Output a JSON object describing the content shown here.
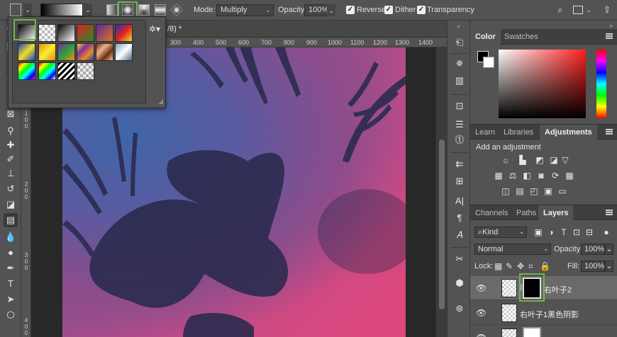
{
  "options_bar": {
    "mode_label": "Mode:",
    "mode_value": "Multiply",
    "opacity_label": "Opacity:",
    "opacity_value": "100%",
    "reverse_label": "Reverse",
    "dither_label": "Dither",
    "transparency_label": "Transparency",
    "reverse_checked": true,
    "dither_checked": true,
    "transparency_checked": true,
    "selected_gradient_type": "radial-gradient",
    "gradient_types": [
      "linear-gradient",
      "radial-gradient",
      "angle-gradient",
      "reflected-gradient",
      "diamond-gradient"
    ],
    "right_icons": [
      "search-icon",
      "workspace-icon",
      "share-icon"
    ]
  },
  "document": {
    "tab_title": "/8) *",
    "hruler_labels": [
      "300",
      "400",
      "500",
      "600",
      "700",
      "800",
      "900",
      "1000",
      "1100",
      "1200",
      "1300",
      "1400",
      "1500"
    ],
    "vruler_labels": [
      "1",
      "0",
      "0",
      "2",
      "0",
      "0",
      "3",
      "0",
      "0",
      "4",
      "0",
      "0"
    ]
  },
  "gradient_picker": {
    "selected_index": 0,
    "presets": [
      "foreground-to-background",
      "foreground-to-transparent",
      "black-white",
      "red-green",
      "violet-orange",
      "blue-red-yellow",
      "blue-yellow-blue",
      "orange-yellow-orange",
      "violet-green-orange",
      "yellow-violet-orange-blue",
      "copper",
      "chrome",
      "spectrum",
      "transparent-rainbow",
      "transparent-stripes",
      "neutral-density"
    ]
  },
  "tools": [
    "move-icon",
    "marquee-icon",
    "lasso-icon",
    "quick-select-icon",
    "crop-icon",
    "frame-icon",
    "eyedropper-icon",
    "healing-icon",
    "brush-icon",
    "stamp-icon",
    "history-brush-icon",
    "eraser-icon",
    "gradient-icon",
    "blur-icon",
    "dodge-icon",
    "pen-icon",
    "type-icon",
    "path-select-icon",
    "shape-icon"
  ],
  "color_panel": {
    "tabs": [
      "Color",
      "Swatches"
    ],
    "active_tab": "Color"
  },
  "adjust_panel": {
    "tabs": [
      "Learn",
      "Libraries",
      "Adjustments"
    ],
    "active_tab": "Adjustments",
    "heading": "Add an adjustment"
  },
  "layers_panel": {
    "tabs": [
      "Channels",
      "Paths",
      "Layers"
    ],
    "active_tab": "Layers",
    "filter_value": "Kind",
    "blend_mode": "Normal",
    "opacity_label": "Opacity:",
    "opacity_value": "100%",
    "lock_label": "Lock:",
    "fill_label": "Fill:",
    "fill_value": "100%",
    "layers": [
      {
        "name": "右叶子2",
        "selected": true,
        "has_mask": true
      },
      {
        "name": "右叶子1黑色阴影",
        "selected": false,
        "has_mask": false
      },
      {
        "name": "",
        "selected": false,
        "has_mask": true
      }
    ]
  },
  "colors": {
    "highlight": "#6fb64a",
    "panel_bg": "#535353",
    "canvas_pink": "#e0477c",
    "canvas_blue": "#3e66a8",
    "leaf": "#2b2b4f"
  }
}
